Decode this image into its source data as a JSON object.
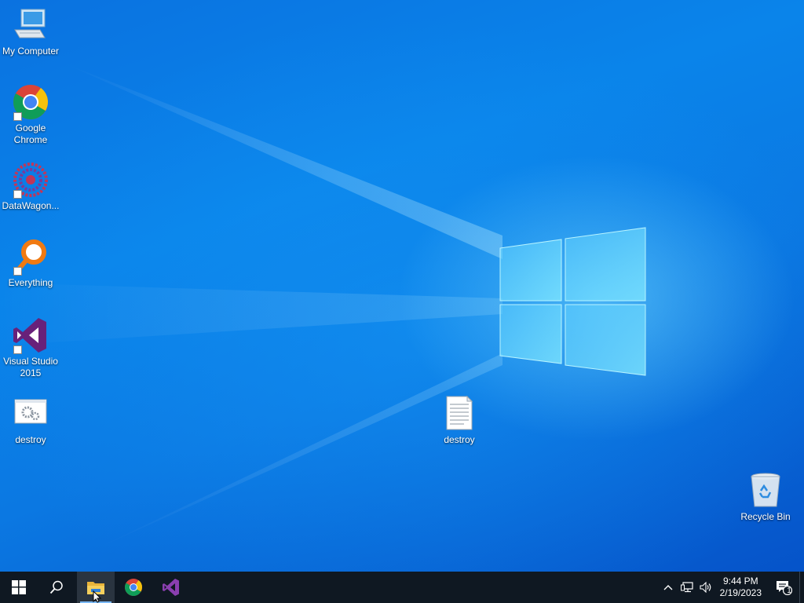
{
  "desktop": {
    "icons": [
      {
        "name": "my-computer",
        "label": "My Computer",
        "icon": "computer-icon",
        "shortcut": false
      },
      {
        "name": "google-chrome",
        "label": "Google Chrome",
        "icon": "chrome-icon",
        "shortcut": true
      },
      {
        "name": "datawagon",
        "label": "DataWagon...",
        "icon": "datawagon-icon",
        "shortcut": true
      },
      {
        "name": "everything",
        "label": "Everything",
        "icon": "everything-search-icon",
        "shortcut": true
      },
      {
        "name": "visual-studio-2015",
        "label": "Visual Studio 2015",
        "icon": "visual-studio-icon",
        "shortcut": true
      },
      {
        "name": "destroy-exe",
        "label": "destroy",
        "icon": "application-gear-icon",
        "shortcut": false
      },
      {
        "name": "destroy-txt",
        "label": "destroy",
        "icon": "text-document-icon",
        "shortcut": false
      },
      {
        "name": "recycle-bin",
        "label": "Recycle Bin",
        "icon": "recycle-bin-icon",
        "shortcut": false
      }
    ]
  },
  "taskbar": {
    "buttons": [
      {
        "name": "start",
        "icon": "windows-logo-icon"
      },
      {
        "name": "search",
        "icon": "search-icon"
      },
      {
        "name": "file-explorer",
        "icon": "folder-icon",
        "active": true
      },
      {
        "name": "chrome",
        "icon": "chrome-icon"
      },
      {
        "name": "visual-studio",
        "icon": "visual-studio-icon"
      }
    ],
    "tray": {
      "time": "9:44 PM",
      "date": "2/19/2023",
      "notification_count": "1",
      "icons": [
        "chevron-up-icon",
        "network-icon",
        "volume-icon"
      ]
    }
  },
  "colors": {
    "taskbar": "#0f1822",
    "accent": "#7ab8f5",
    "wallpaper_blue": "#0a7ae6"
  }
}
